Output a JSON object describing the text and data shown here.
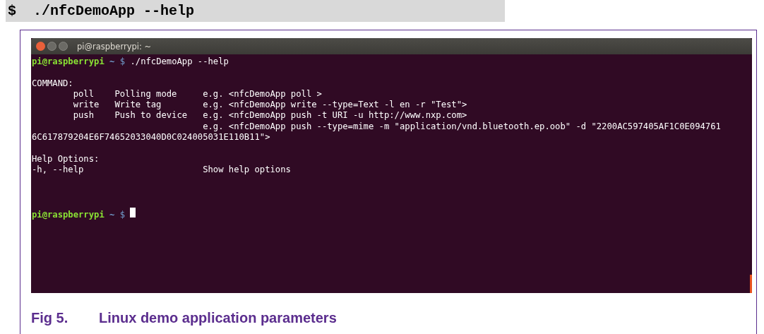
{
  "code_block": {
    "text": "$  ./nfcDemoApp --help"
  },
  "terminal": {
    "title": "pi@raspberrypi: ~",
    "lines": [
      {
        "kind": "prompt",
        "user": "pi@raspberrypi",
        "path": "~",
        "symbol": "$",
        "command": "./nfcDemoApp --help",
        "cursor": false
      },
      {
        "kind": "blank"
      },
      {
        "kind": "text",
        "text": "COMMAND:"
      },
      {
        "kind": "text",
        "text": "        poll    Polling mode     e.g. <nfcDemoApp poll >"
      },
      {
        "kind": "text",
        "text": "        write   Write tag        e.g. <nfcDemoApp write --type=Text -l en -r \"Test\">"
      },
      {
        "kind": "text",
        "text": "        push    Push to device   e.g. <nfcDemoApp push -t URI -u http://www.nxp.com>"
      },
      {
        "kind": "text",
        "text": "                                 e.g. <nfcDemoApp push --type=mime -m \"application/vnd.bluetooth.ep.oob\" -d \"2200AC597405AF1C0E094761"
      },
      {
        "kind": "text",
        "text": "6C617879204E6F74652033040D0C024005031E110B11\">"
      },
      {
        "kind": "blank"
      },
      {
        "kind": "text",
        "text": "Help Options:"
      },
      {
        "kind": "text",
        "text": "-h, --help                       Show help options"
      },
      {
        "kind": "blank"
      },
      {
        "kind": "blank"
      },
      {
        "kind": "blank"
      },
      {
        "kind": "prompt",
        "user": "pi@raspberrypi",
        "path": "~",
        "symbol": "$",
        "cursor": true
      }
    ]
  },
  "caption": {
    "number": "Fig 5.",
    "text": "Linux demo application parameters"
  }
}
